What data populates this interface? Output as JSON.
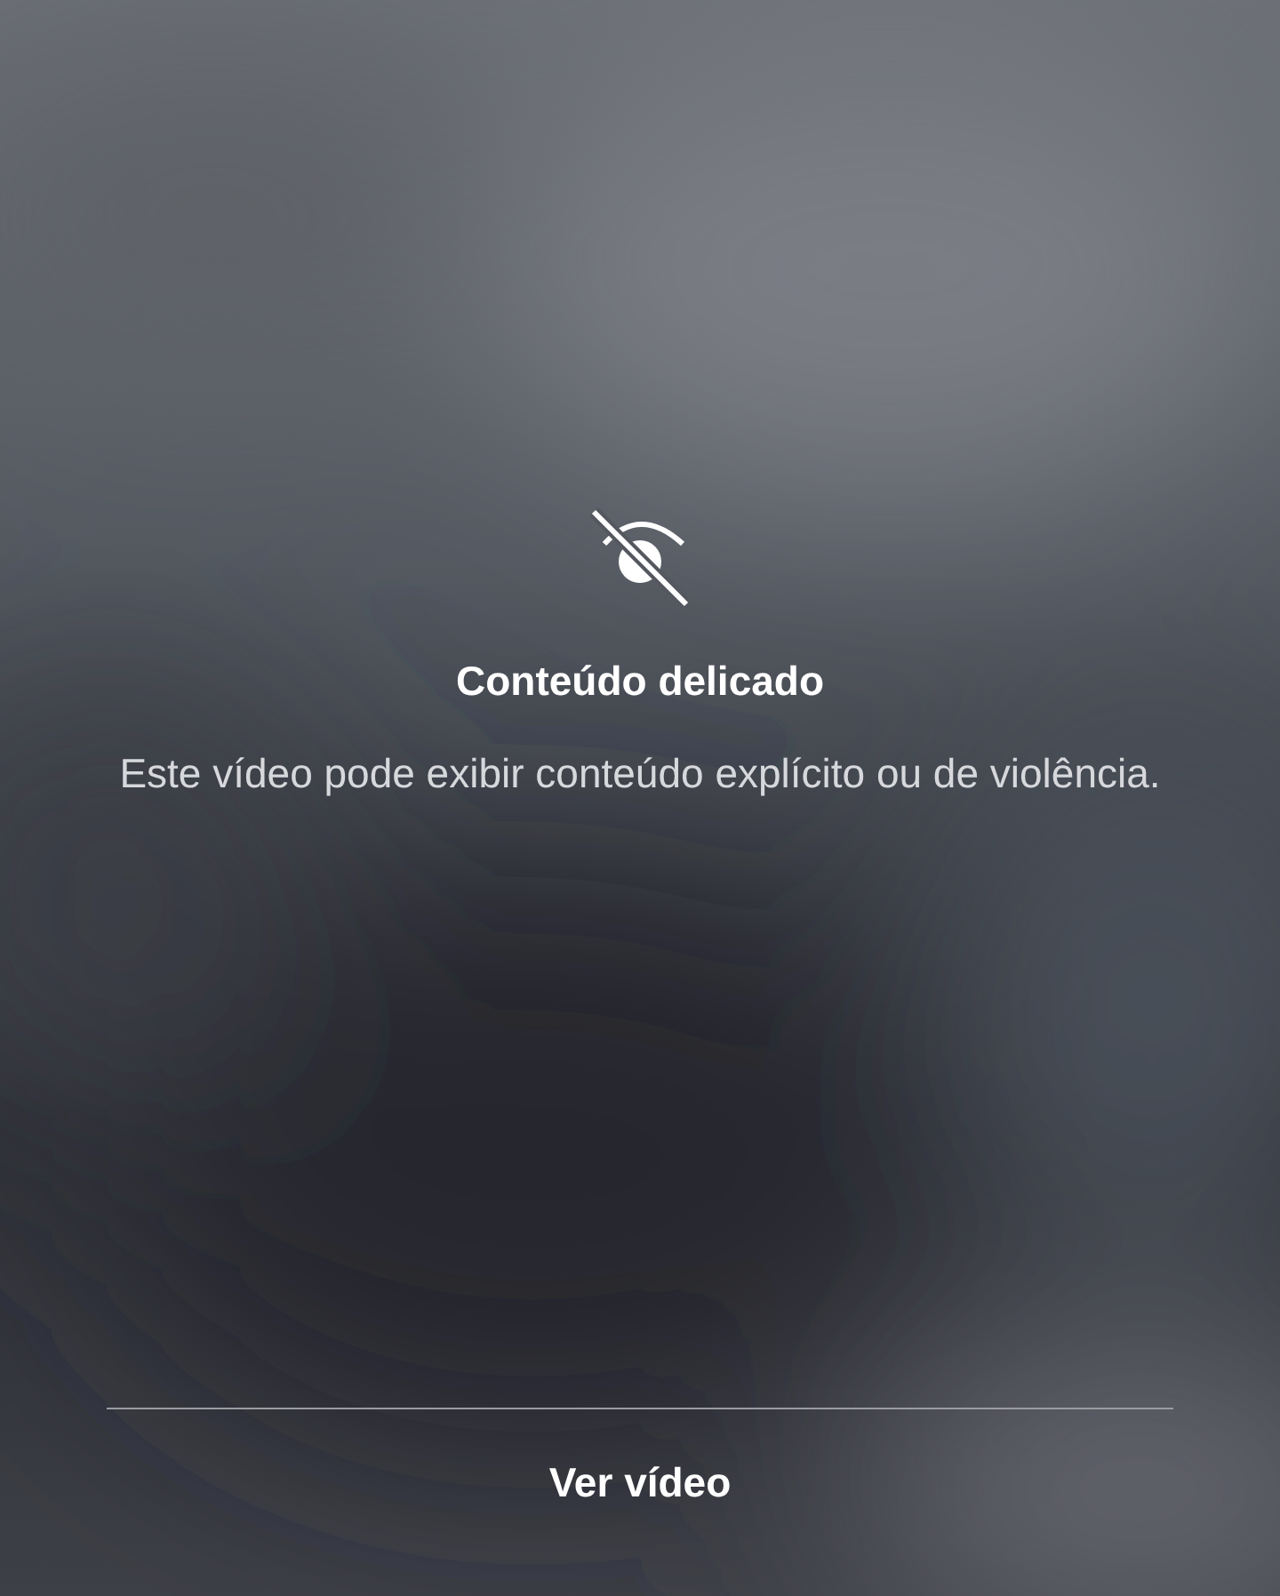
{
  "warning": {
    "title": "Conteúdo delicado",
    "message": "Este vídeo pode exibir conteúdo explícito ou de violência."
  },
  "action": {
    "label": "Ver vídeo"
  }
}
